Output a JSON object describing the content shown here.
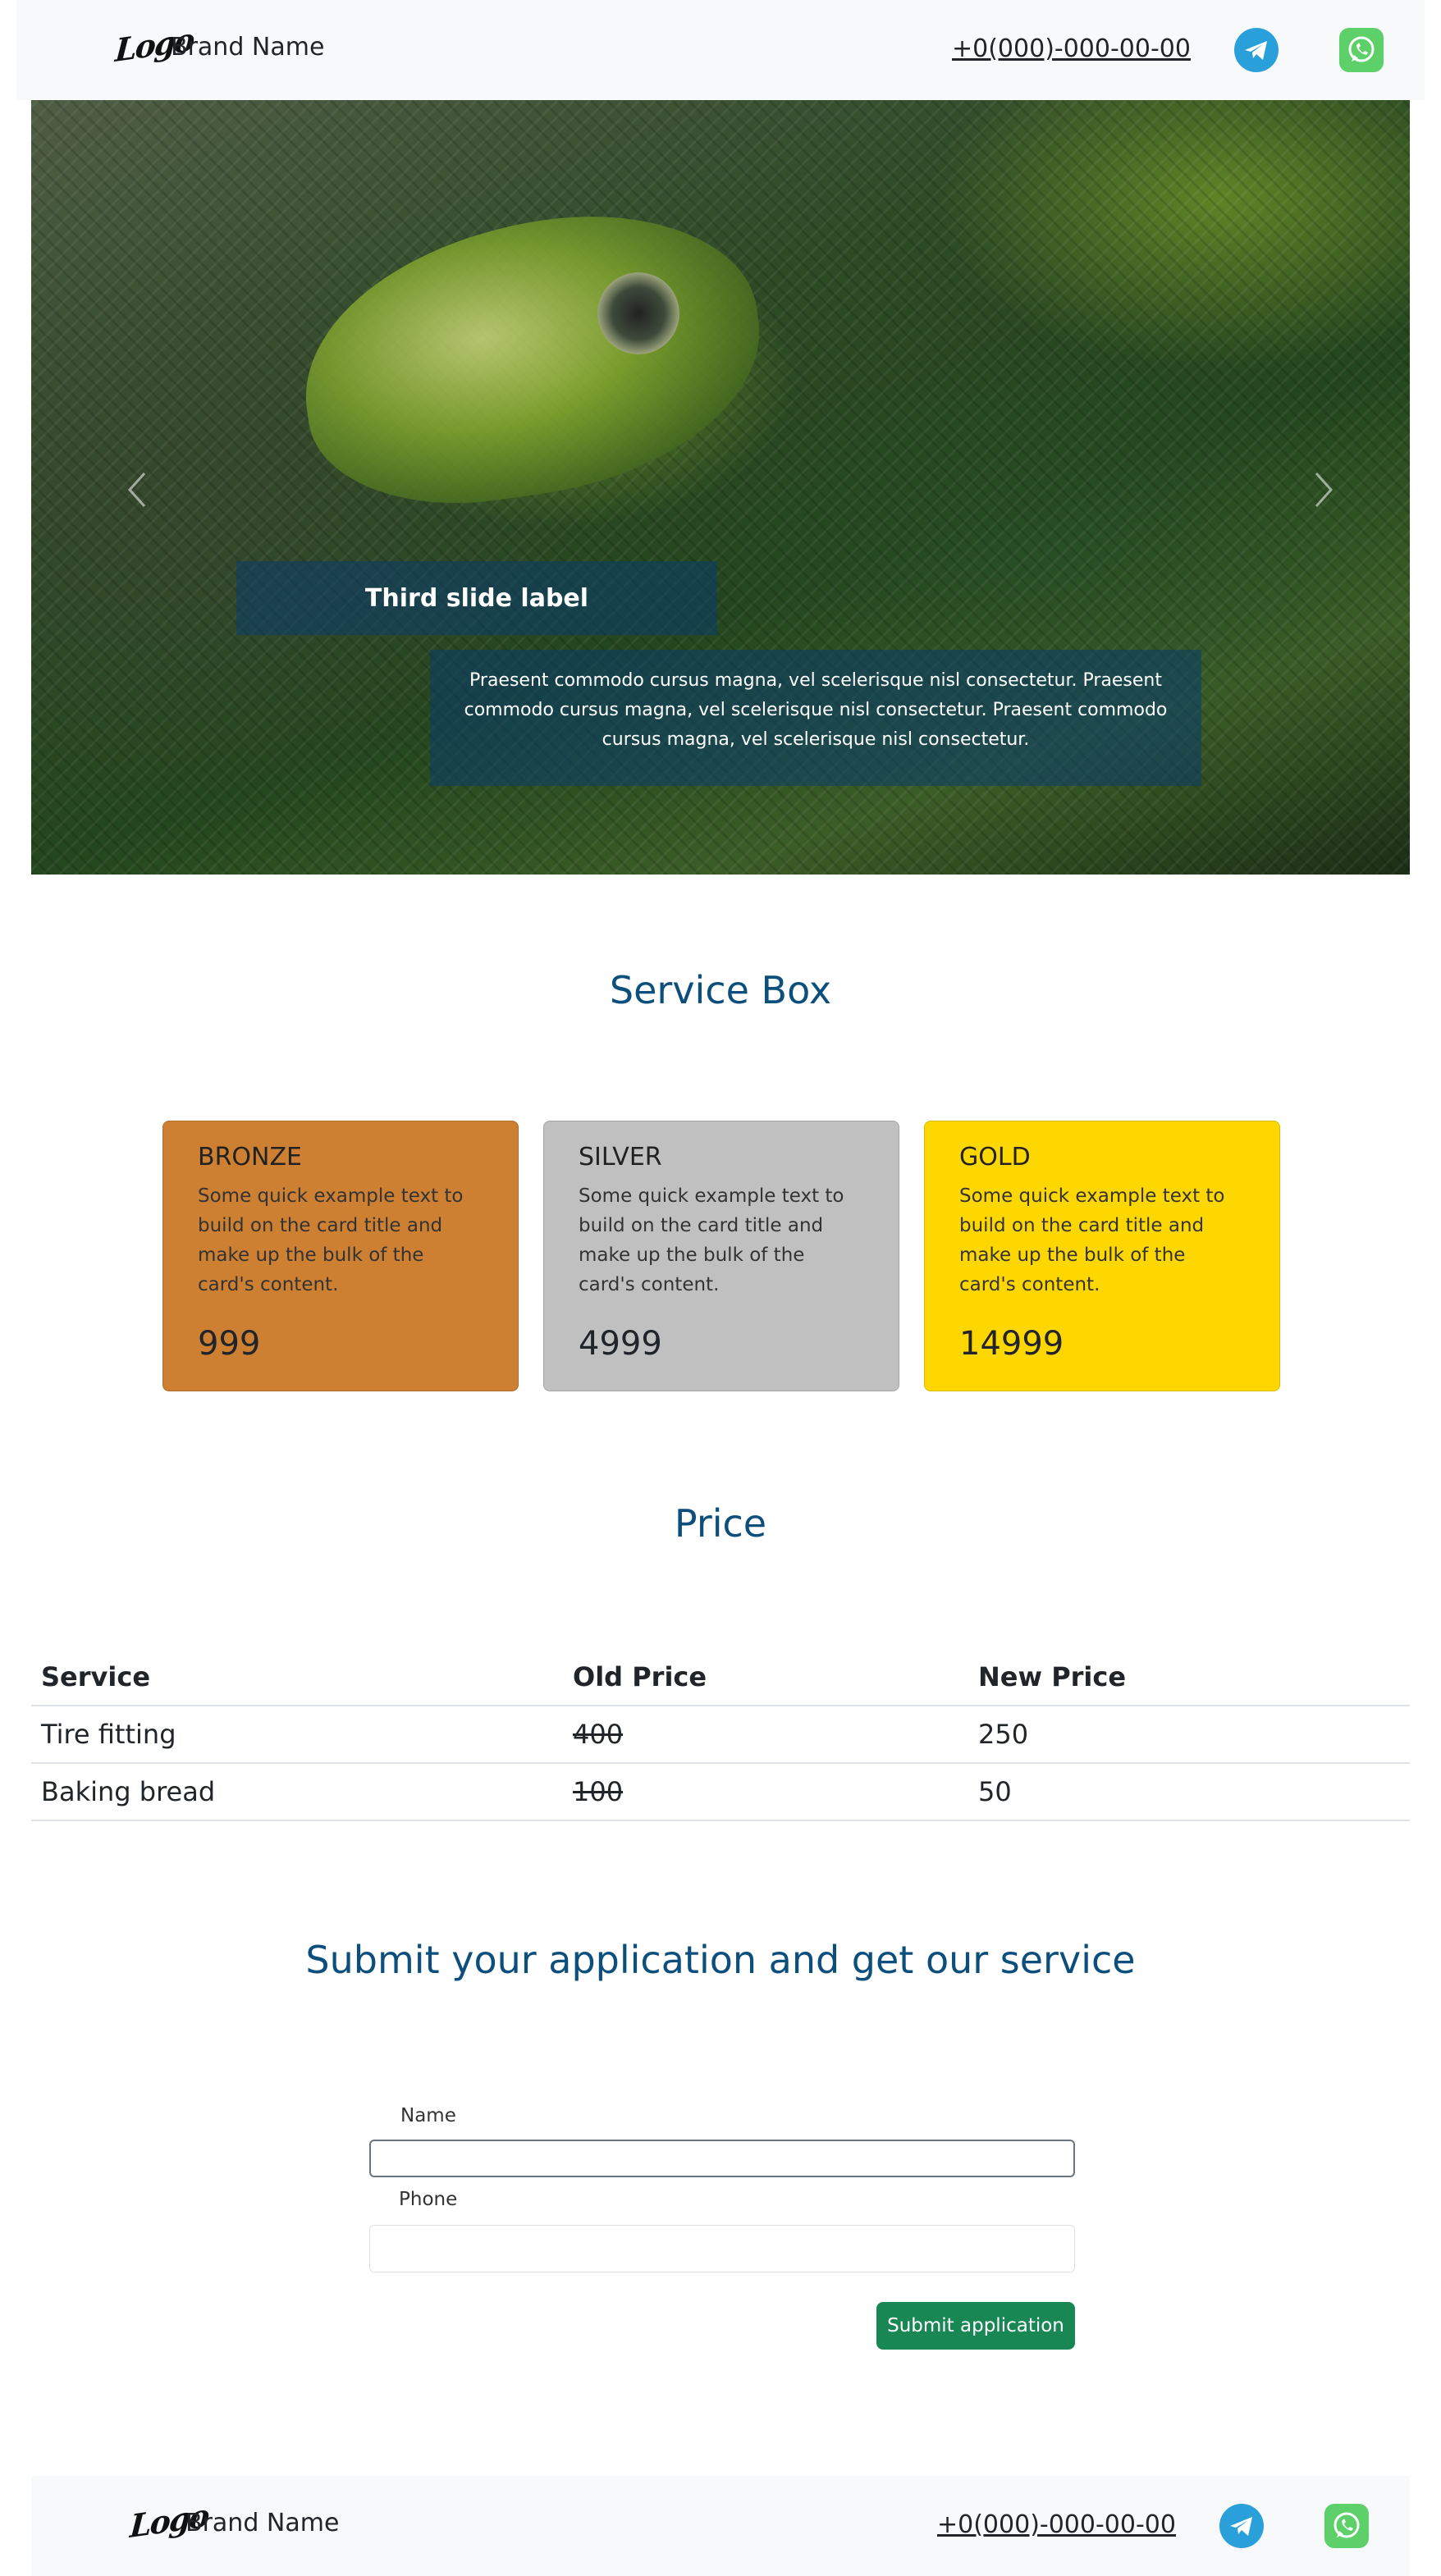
{
  "header": {
    "logo_text": "Logo",
    "brand_name": "Brand Name",
    "phone": "+0(000)-000-00-00",
    "icons": [
      "telegram-icon",
      "whatsapp-icon"
    ]
  },
  "carousel": {
    "caption_label": "Third slide label",
    "caption_text": "Praesent commodo cursus magna, vel scelerisque nisl consectetur. Praesent commodo cursus magna, vel scelerisque nisl consectetur. Praesent commodo cursus magna, vel scelerisque nisl consectetur.",
    "controls": [
      "chevron-left-icon",
      "chevron-right-icon"
    ]
  },
  "services": {
    "title": "Service Box",
    "cards": [
      {
        "name": "BRONZE",
        "text": "Some quick example text to build on the card title and make up the bulk of the card's content.",
        "price": "999",
        "color": "#cd7f32"
      },
      {
        "name": "SILVER",
        "text": "Some quick example text to build on the card title and make up the bulk of the card's content.",
        "price": "4999",
        "color": "#c0c0c0"
      },
      {
        "name": "GOLD",
        "text": "Some quick example text to build on the card title and make up the bulk of the card's content.",
        "price": "14999",
        "color": "#ffd700"
      }
    ]
  },
  "price": {
    "title": "Price",
    "headers": [
      "Service",
      "Old Price",
      "New Price"
    ],
    "rows": [
      [
        "Tire fitting",
        "400",
        "250"
      ],
      [
        "Baking bread",
        "100",
        "50"
      ]
    ]
  },
  "form": {
    "title": "Submit your application and get our service",
    "name_label": "Name",
    "name_value": "",
    "phone_label": "Phone",
    "phone_value": "",
    "submit_label": "Submit application"
  },
  "footer": {
    "logo_text": "Logo",
    "brand_name": "Brand Name",
    "phone": "+0(000)-000-00-00"
  },
  "colors": {
    "accent_title": "#0d4f7c",
    "submit": "#198754",
    "telegram": "#2aa0da",
    "whatsapp": "#5dd06a",
    "caption_bg": "#0a3c6e"
  }
}
